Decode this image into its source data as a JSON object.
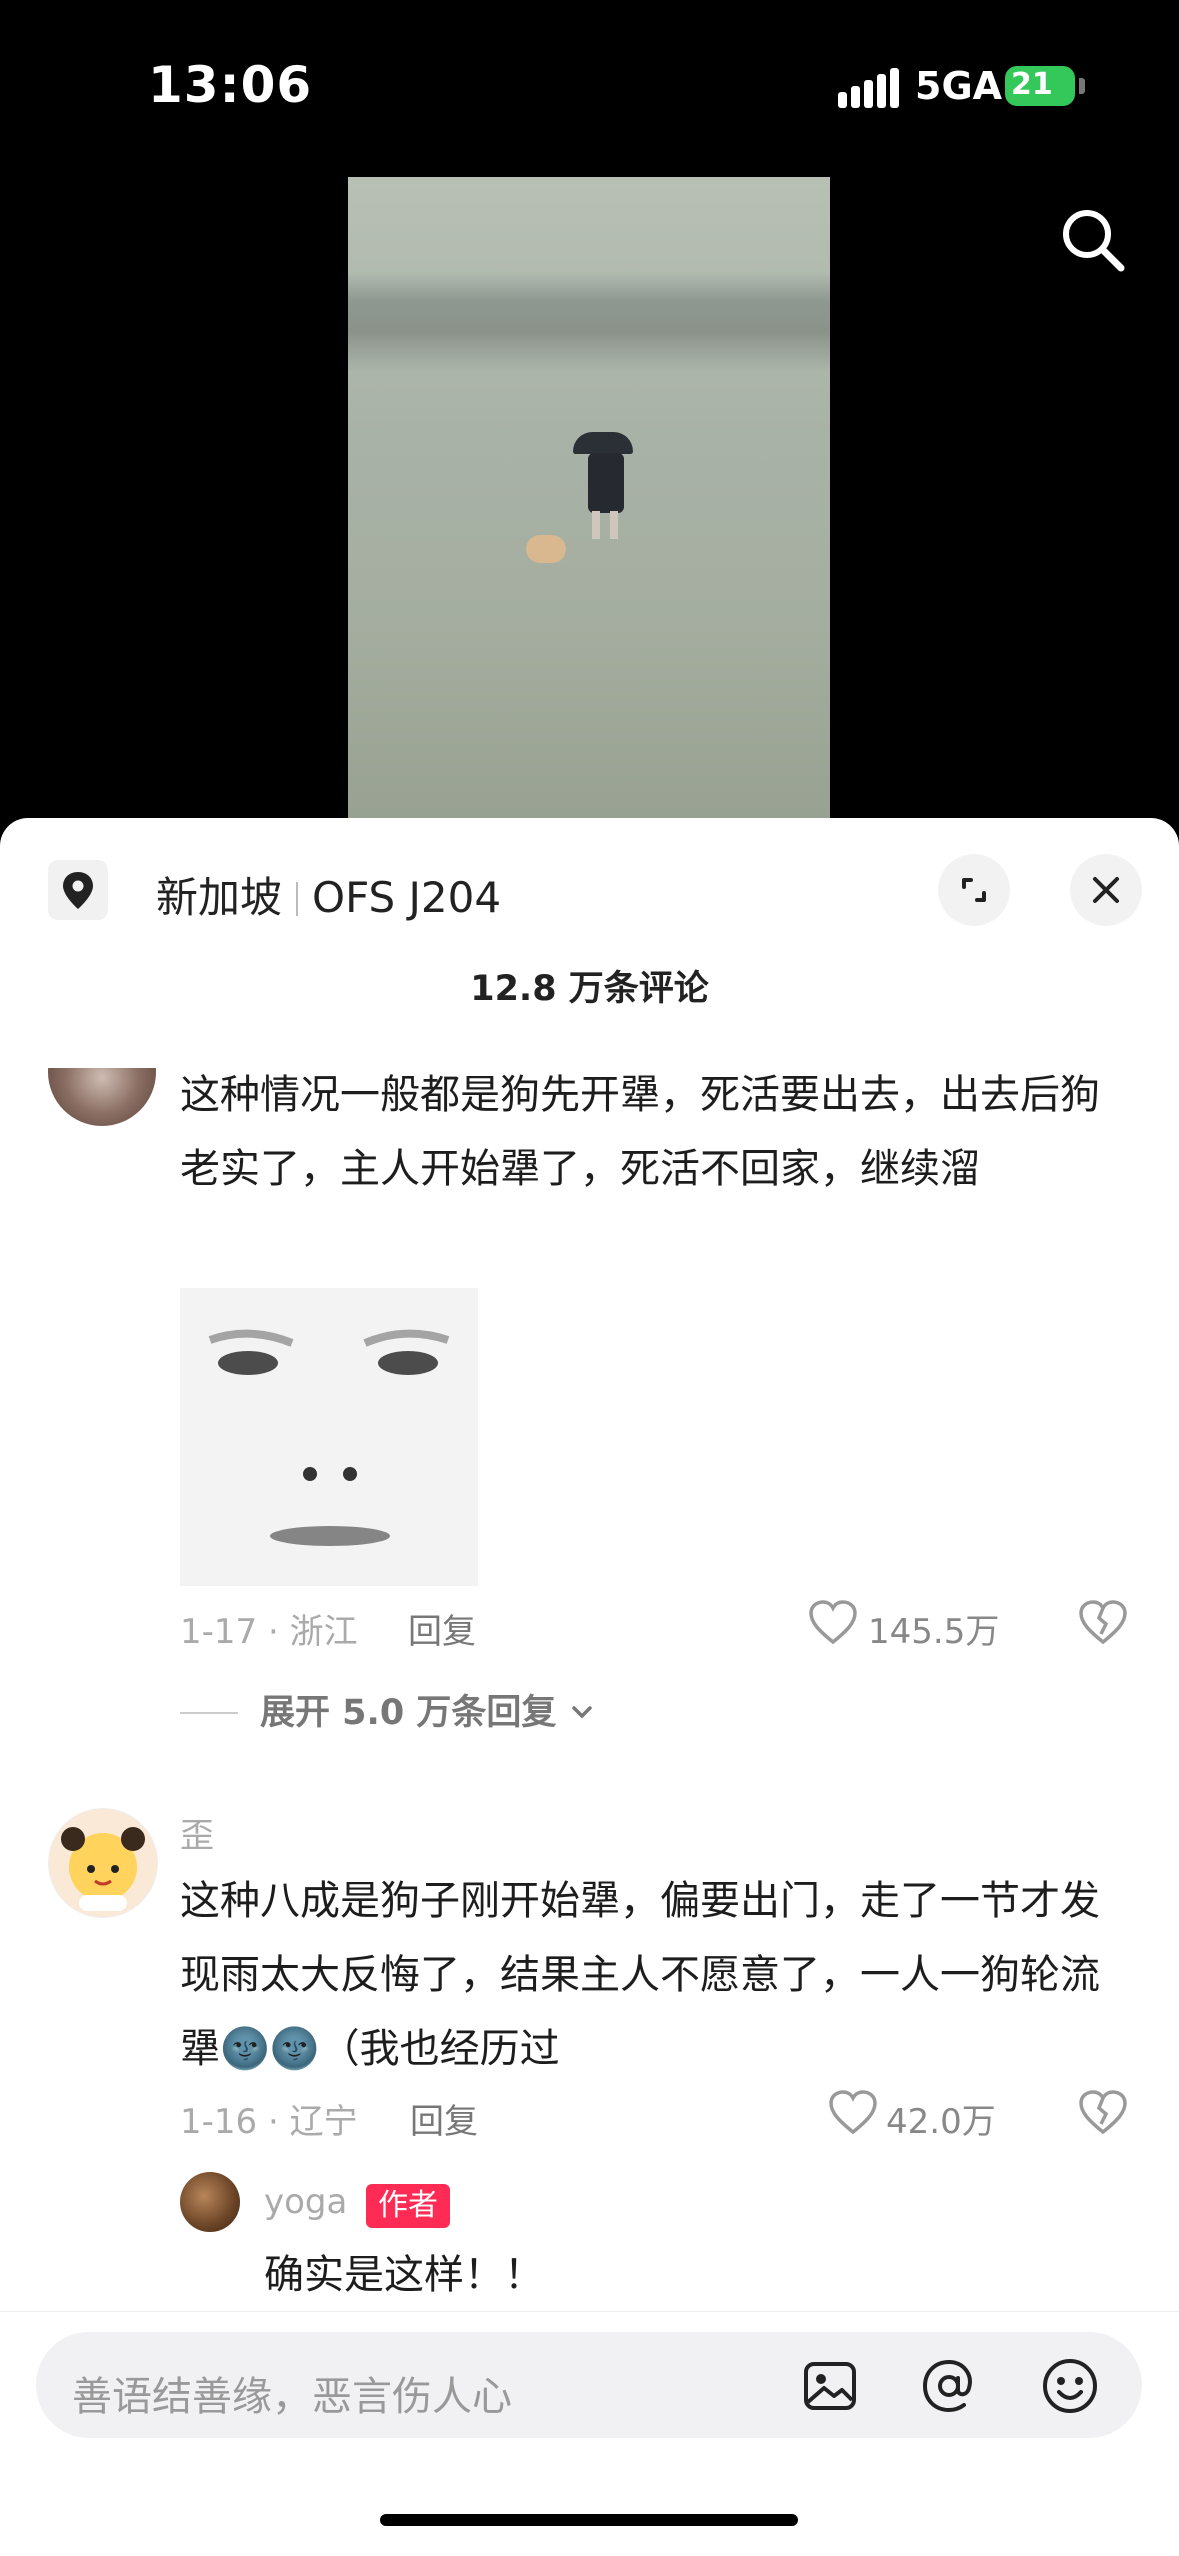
{
  "status": {
    "time": "13:06",
    "network": "5GA",
    "battery": "21"
  },
  "location": {
    "city": "新加坡",
    "place": "OFS J204"
  },
  "comments_title": "12.8 万条评论",
  "comments": [
    {
      "text": "这种情况一般都是狗先开犟，死活要出去，出去后狗老实了，主人开始犟了，死活不回家，继续溜",
      "meta": "1-17 · 浙江",
      "reply": "回复",
      "likes": "145.5万",
      "expand": "展开 5.0 万条回复"
    },
    {
      "username": "歪",
      "text": "这种八成是狗子刚开始犟，偏要出门，走了一节才发现雨太大反悔了，结果主人不愿意了，一人一狗轮流犟🌚🌚（我也经历过",
      "meta": "1-16 · 辽宁",
      "reply": "回复",
      "likes": "42.0万"
    }
  ],
  "sub_reply": {
    "username": "yoga",
    "badge": "作者",
    "text": "确实是这样！！"
  },
  "input": {
    "placeholder": "善语结善缘，恶言伤人心"
  },
  "icons": [
    "search-icon",
    "location-pin-icon",
    "expand-icon",
    "close-icon",
    "heart-icon",
    "dislike-icon",
    "image-icon",
    "at-icon",
    "emoji-icon"
  ]
}
